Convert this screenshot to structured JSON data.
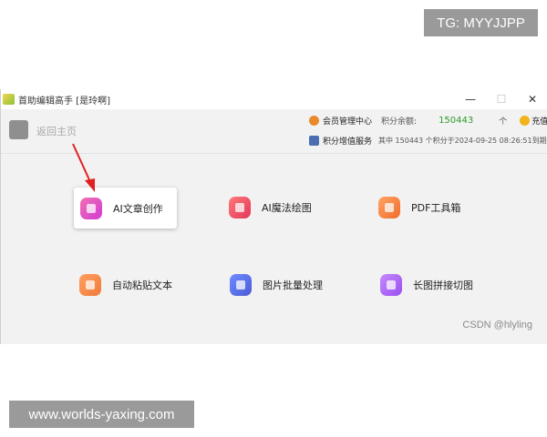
{
  "watermarks": {
    "top": "TG: MYYJJPP",
    "bottom": "www.worlds-yaxing.com"
  },
  "window": {
    "title": "首助编辑高手 [是玲啊]",
    "controls": {
      "minimize": "—",
      "maximize": "☐",
      "close": "✕"
    }
  },
  "header": {
    "back_label": "返回主页",
    "member_center": "会员管理中心",
    "balance_label": "积分余额:",
    "balance_value": "150443",
    "balance_unit": "个",
    "recharge": "充值",
    "points_service": "积分增值服务",
    "points_detail": "其中 150443 个积分于2024-09-25 08:26:51到期"
  },
  "tools": [
    {
      "label": "AI文章创作",
      "icon": "document-icon",
      "color": "#e04fc2"
    },
    {
      "label": "AI魔法绘图",
      "icon": "image-icon",
      "color": "#e84b6a"
    },
    {
      "label": "PDF工具箱",
      "icon": "pdf-icon",
      "color": "#f07a3a"
    },
    {
      "label": "自动粘贴文本",
      "icon": "clipboard-icon",
      "color": "#f58a4a"
    },
    {
      "label": "图片批量处理",
      "icon": "layers-icon",
      "color": "#5566e0"
    },
    {
      "label": "长图拼接切图",
      "icon": "stitch-icon",
      "color": "#a35cf2"
    }
  ],
  "credit": "CSDN @hlyling",
  "colors": {
    "accent_green": "#2e9a2e",
    "arrow_red": "#e02020",
    "window_bg": "#f2f2f2"
  }
}
